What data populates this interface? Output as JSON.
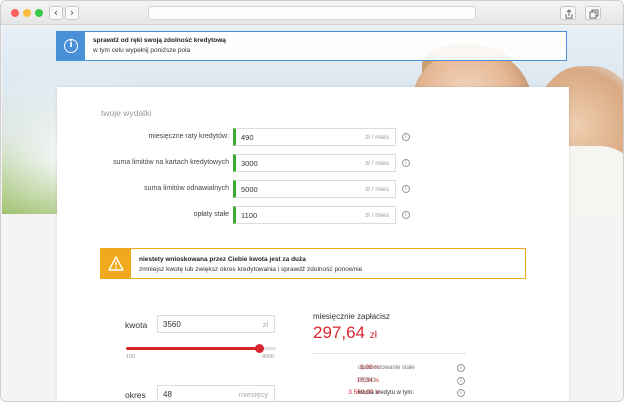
{
  "browser": {
    "back_glyph": "‹",
    "forward_glyph": "›",
    "share_icon": "share-icon",
    "tabs_icon": "tabs-icon"
  },
  "info_banner": {
    "icon": "info-icon",
    "icon_glyph": "i",
    "title": "sprawdź od ręki swoją zdolność kredytową",
    "subtitle": "w tym celu wypełnij poniższe pola",
    "accent": "#4a90d9"
  },
  "expenses": {
    "title": "twoje wydatki",
    "rows": [
      {
        "label": "miesięczne raty kredytów:",
        "value": "490",
        "unit": "zł / mies"
      },
      {
        "label": "suma limitów na kartach kredytowych",
        "value": "3000",
        "unit": "zł / mies"
      },
      {
        "label": "suma limitów odnawialnych",
        "value": "5000",
        "unit": "zł / mies"
      },
      {
        "label": "opłaty stałe",
        "value": "1100",
        "unit": "zł / mies"
      }
    ],
    "help_glyph": "i",
    "accent": "#3aaa35"
  },
  "warning": {
    "icon": "warning-icon",
    "title": "niestety wnioskowana przez Ciebie kwota jest za duża",
    "subtitle": "zmniejsz kwotę lub zwiększ okres kredytowania i sprawdź zdolność ponownie",
    "accent": "#f0a81c"
  },
  "calculator": {
    "amount_label": "kwota",
    "amount_value": "3560",
    "amount_unit": "zł",
    "slider_min": "100",
    "slider_max": "4000",
    "slider_value": 3560,
    "period_label": "okres",
    "period_value": "48",
    "period_unit": "miesięcy",
    "accent": "#d8262f"
  },
  "result": {
    "label": "miesięcznie zapłacisz",
    "amount": "297,64",
    "currency": "zł",
    "stats": [
      {
        "value": "8,99",
        "suffix": "%",
        "label": "oprocentowanie stałe"
      },
      {
        "value": "13,34",
        "suffix": "%",
        "label": "RRSO"
      },
      {
        "value": "3 560,00",
        "suffix": "zł",
        "label": "kwota kredytu w tym:"
      }
    ]
  }
}
